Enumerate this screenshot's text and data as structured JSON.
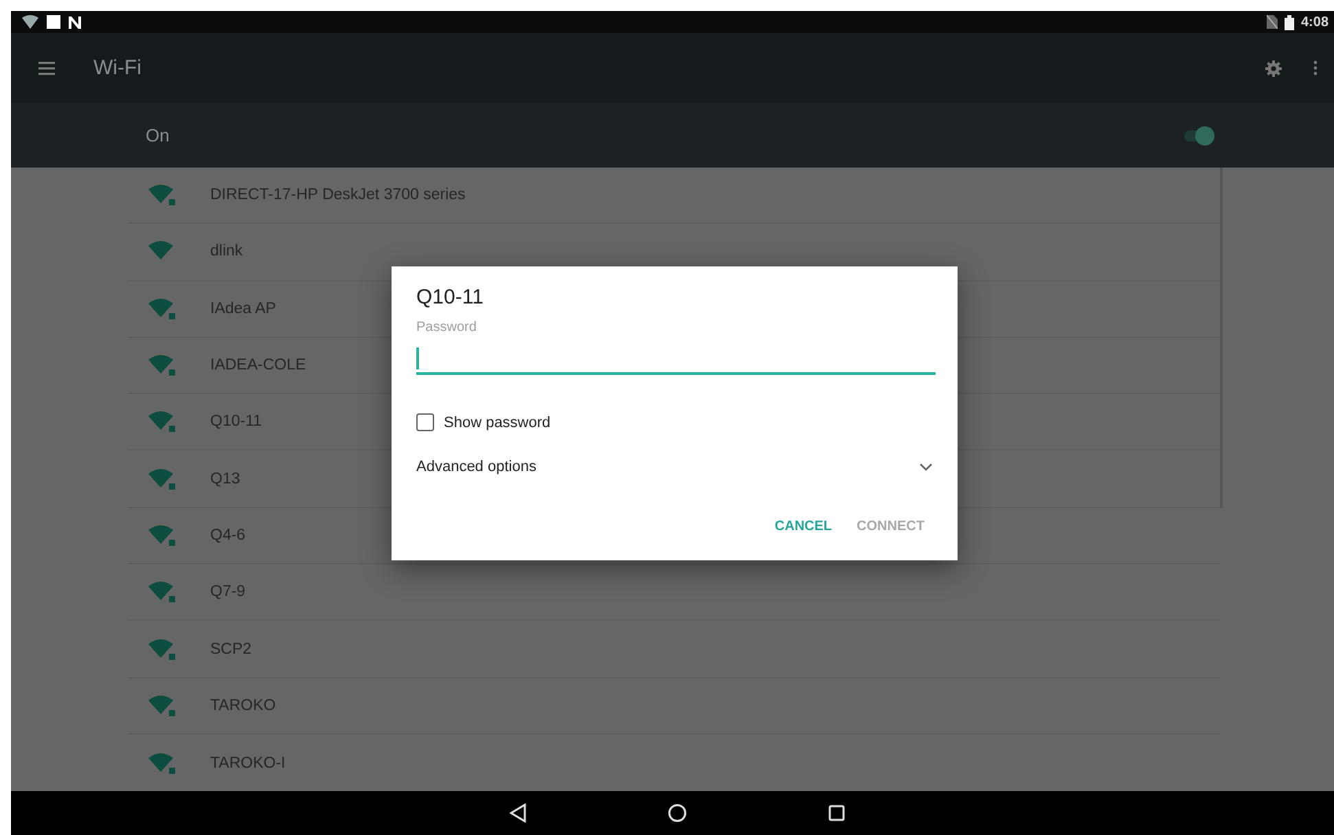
{
  "status_bar": {
    "time": "4:08"
  },
  "toolbar": {
    "title": "Wi-Fi"
  },
  "wifi_switch": {
    "label": "On",
    "on": true
  },
  "networks": [
    {
      "name": "DIRECT-17-HP DeskJet 3700 series",
      "secured": true
    },
    {
      "name": "dlink",
      "secured": false
    },
    {
      "name": "IAdea AP",
      "secured": true
    },
    {
      "name": "IADEA-COLE",
      "secured": true
    },
    {
      "name": "Q10-11",
      "secured": true
    },
    {
      "name": "Q13",
      "secured": true
    },
    {
      "name": "Q4-6",
      "secured": true
    },
    {
      "name": "Q7-9",
      "secured": true
    },
    {
      "name": "SCP2",
      "secured": true
    },
    {
      "name": "TAROKO",
      "secured": true
    },
    {
      "name": "TAROKO-I",
      "secured": true
    }
  ],
  "dialog": {
    "title": "Q10-11",
    "password_field": {
      "label": "Password"
    },
    "show_password": {
      "label": "Show password",
      "checked": false
    },
    "advanced_options": {
      "label": "Advanced options",
      "expanded": false
    },
    "buttons": [
      {
        "label": "CANCEL",
        "disabled": false
      },
      {
        "label": "CONNECT",
        "disabled": true
      }
    ]
  }
}
